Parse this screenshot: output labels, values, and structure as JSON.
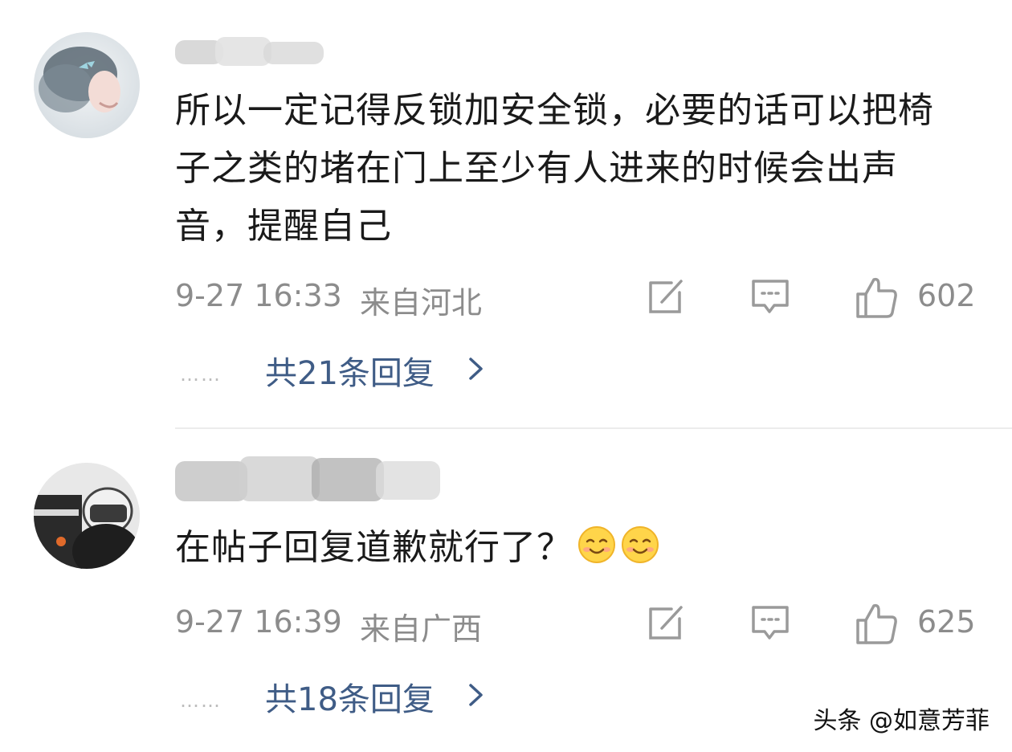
{
  "comments": [
    {
      "text": "所以一定记得反锁加安全锁，必要的话可以把椅子之类的堵在门上至少有人进来的时候会出声音，提醒自己",
      "time": "9-27 16:33",
      "location": "来自河北",
      "likes": "602",
      "replies_label": "共21条回复",
      "dots": "……",
      "emojis": []
    },
    {
      "text": "在帖子回复道歉就行了？",
      "time": "9-27 16:39",
      "location": "来自广西",
      "likes": "625",
      "replies_label": "共18条回复",
      "dots": "……",
      "emojis": [
        "smiling-face-emoji",
        "smiling-face-emoji"
      ]
    }
  ],
  "watermark": "头条 @如意芳菲",
  "colors": {
    "text": "#1a1a1a",
    "meta": "#8c8c8c",
    "link": "#3f5c86",
    "divider": "#ececec"
  },
  "icons": [
    "edit-icon",
    "comment-icon",
    "thumbs-up-icon",
    "chevron-right-icon"
  ]
}
